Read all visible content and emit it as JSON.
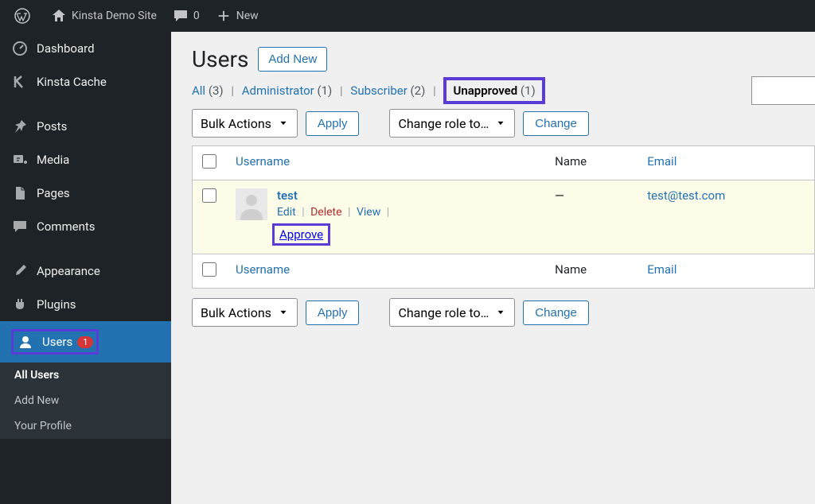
{
  "adminbar": {
    "site_title": "Kinsta Demo Site",
    "comment_count": "0",
    "new_label": "New"
  },
  "sidebar": {
    "items": [
      {
        "id": "dashboard",
        "label": "Dashboard"
      },
      {
        "id": "kinsta-cache",
        "label": "Kinsta Cache"
      },
      {
        "id": "posts",
        "label": "Posts"
      },
      {
        "id": "media",
        "label": "Media"
      },
      {
        "id": "pages",
        "label": "Pages"
      },
      {
        "id": "comments",
        "label": "Comments"
      },
      {
        "id": "appearance",
        "label": "Appearance"
      },
      {
        "id": "plugins",
        "label": "Plugins"
      },
      {
        "id": "users",
        "label": "Users",
        "badge": "1"
      }
    ],
    "submenu": [
      {
        "label": "All Users"
      },
      {
        "label": "Add New"
      },
      {
        "label": "Your Profile"
      }
    ]
  },
  "page": {
    "title": "Users",
    "add_new": "Add New"
  },
  "filters": {
    "all_label": "All",
    "all_count": "(3)",
    "admin_label": "Administrator",
    "admin_count": "(1)",
    "sub_label": "Subscriber",
    "sub_count": "(2)",
    "unapproved_label": "Unapproved",
    "unapproved_count": "(1)"
  },
  "actions": {
    "bulk_label": "Bulk Actions",
    "apply_label": "Apply",
    "role_label": "Change role to…",
    "change_label": "Change"
  },
  "columns": {
    "username": "Username",
    "name": "Name",
    "email": "Email"
  },
  "rows": [
    {
      "username": "test",
      "name": "—",
      "email": "test@test.com",
      "actions": {
        "edit": "Edit",
        "delete": "Delete",
        "view": "View",
        "approve": "Approve"
      }
    }
  ]
}
